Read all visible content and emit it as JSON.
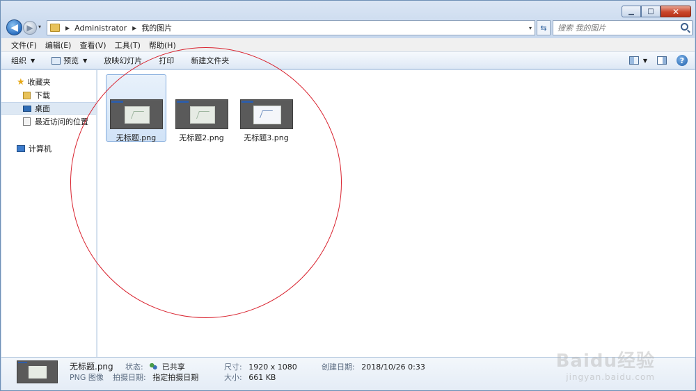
{
  "window": {
    "caption": {
      "minimize": "▁",
      "maximize": "□",
      "close": "✕"
    }
  },
  "nav": {
    "back_icon": "◀",
    "forward_icon": "▶",
    "dropdown_icon": "▾",
    "breadcrumb": [
      "Administrator",
      "我的图片"
    ],
    "separator": "▶",
    "refresh_icon": "⇆",
    "search_placeholder": "搜索 我的图片"
  },
  "menubar": [
    "文件(F)",
    "编辑(E)",
    "查看(V)",
    "工具(T)",
    "帮助(H)"
  ],
  "commandbar": {
    "organize": "组织",
    "preview": "预览",
    "slideshow": "放映幻灯片",
    "print": "打印",
    "new_folder": "新建文件夹",
    "arrow": "▼",
    "help": "?"
  },
  "sidebar": {
    "favorites": "收藏夹",
    "items": [
      "下载",
      "桌面",
      "最近访问的位置"
    ],
    "computer": "计算机"
  },
  "files": [
    {
      "name": "无标题.png",
      "selected": true
    },
    {
      "name": "无标题2.png",
      "selected": false
    },
    {
      "name": "无标题3.png",
      "selected": false
    }
  ],
  "details": {
    "filename": "无标题.png",
    "filetype": "PNG 图像",
    "status_label": "状态:",
    "status_value": "已共享",
    "date_taken_label": "拍摄日期:",
    "date_taken_value": "指定拍摄日期",
    "dimensions_label": "尺寸:",
    "dimensions_value": "1920 x 1080",
    "size_label": "大小:",
    "size_value": "661 KB",
    "created_label": "创建日期:",
    "created_value": "2018/10/26 0:33"
  },
  "watermark": {
    "logo": "Baidu经验",
    "url": "jingyan.baidu.com"
  },
  "colors": {
    "annotation_circle": "#d9232f",
    "selection": "#d1e3f7"
  }
}
